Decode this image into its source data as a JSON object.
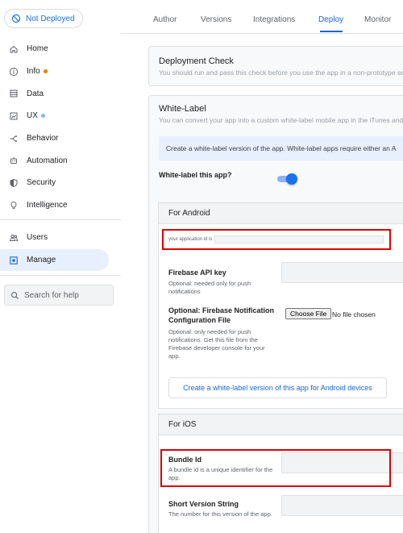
{
  "sidebar": {
    "deploy_status": "Not Deployed",
    "items": [
      {
        "label": "Home",
        "icon": "home-icon"
      },
      {
        "label": "Info",
        "icon": "info-icon",
        "dot": "#f57c00"
      },
      {
        "label": "Data",
        "icon": "database-icon"
      },
      {
        "label": "UX",
        "icon": "ux-icon",
        "dot": "#8ab4f8"
      },
      {
        "label": "Behavior",
        "icon": "behavior-icon"
      },
      {
        "label": "Automation",
        "icon": "robot-icon"
      },
      {
        "label": "Security",
        "icon": "shield-icon"
      },
      {
        "label": "Intelligence",
        "icon": "lightbulb-icon"
      },
      {
        "label": "Users",
        "icon": "users-icon"
      },
      {
        "label": "Manage",
        "icon": "manage-icon"
      }
    ],
    "search_placeholder": "Search for help"
  },
  "tabs": [
    "Author",
    "Versions",
    "Integrations",
    "Deploy",
    "Monitor"
  ],
  "active_tab": "Deploy",
  "deployment_check": {
    "title": "Deployment Check",
    "subtitle": "You should run and pass this check before you use the app in a non-prototype se"
  },
  "white_label": {
    "title": "White-Label",
    "subtitle": "You can convert your app into a custom white-label mobile app in the iTunes and G",
    "banner": "Create a white-label version of the app. White-label apps require either an A",
    "toggle_label": "White-label this app?",
    "toggle_on": true,
    "android": {
      "heading": "For Android",
      "app_id_label": "your application id is",
      "firebase_key_label": "Firebase API key",
      "firebase_key_help": "Optional: needed only for push notifications",
      "firebase_config_label": "Optional: Firebase Notification Configuration File",
      "firebase_config_help": "Optional: only needed for push notifications. Get this file from the Firebase developer console for your app.",
      "choose_file": "Choose File",
      "no_file": "No file chosen",
      "create_button": "Create a white-label version of this app for Android devices"
    },
    "ios": {
      "heading": "For iOS",
      "bundle_id_label": "Bundle Id",
      "bundle_id_help": "A bundle id is a unique identifier for the app.",
      "version_label": "Short Version String",
      "version_help": "The number for this version of the app."
    }
  },
  "colors": {
    "accent": "#1967d2",
    "highlight_red": "#e00000"
  }
}
